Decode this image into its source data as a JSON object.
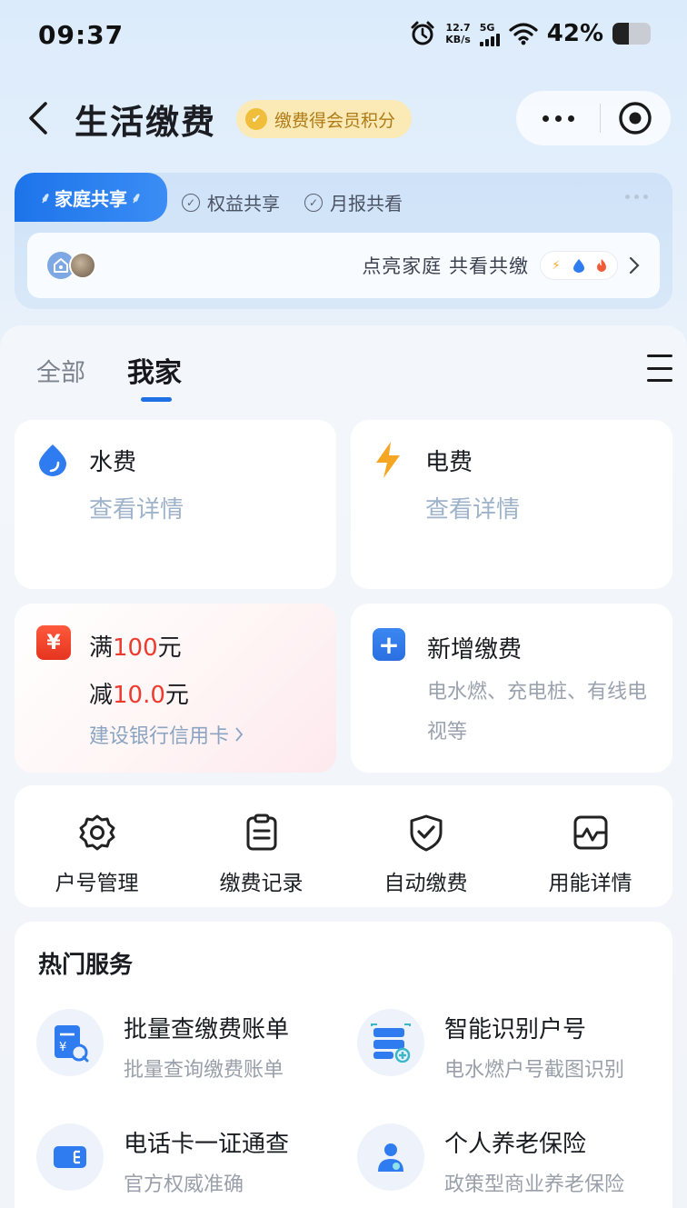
{
  "status_bar": {
    "time": "09:37",
    "net_speed_value": "12.7",
    "net_speed_unit": "KB/s",
    "network": "5G",
    "battery": "42%",
    "battery_level": 0.42
  },
  "header": {
    "title": "生活缴费",
    "points_badge": "缴费得会员积分"
  },
  "family": {
    "tab_label": "家庭共享",
    "share_items": [
      "权益共享",
      "月报共看"
    ],
    "prompt": "点亮家庭 共看共缴"
  },
  "tabs": [
    {
      "label": "全部",
      "active": false
    },
    {
      "label": "我家",
      "active": true
    }
  ],
  "cards": {
    "water": {
      "title": "水费",
      "sub": "查看详情"
    },
    "electric": {
      "title": "电费",
      "sub": "查看详情"
    },
    "promo": {
      "line1_prefix": "满",
      "line1_amount": "100",
      "line1_suffix": "元",
      "line2_prefix": "减",
      "line2_amount": "10.0",
      "line2_suffix": "元",
      "link": "建设银行信用卡"
    },
    "new_payment": {
      "title": "新增缴费",
      "desc": "电水燃、充电桩、有线电视等"
    }
  },
  "quick_actions": [
    {
      "label": "户号管理",
      "icon": "gear-icon"
    },
    {
      "label": "缴费记录",
      "icon": "clipboard-icon"
    },
    {
      "label": "自动缴费",
      "icon": "shield-check-icon"
    },
    {
      "label": "用能详情",
      "icon": "chart-icon"
    }
  ],
  "hot_services": {
    "title": "热门服务",
    "items": [
      {
        "name": "批量查缴费账单",
        "desc": "批量查询缴费账单"
      },
      {
        "name": "智能识别户号",
        "desc": "电水燃户号截图识别"
      },
      {
        "name": "电话卡一证通查",
        "desc": "官方权威准确"
      },
      {
        "name": "个人养老保险",
        "desc": "政策型商业养老保险"
      }
    ]
  },
  "colors": {
    "accent": "#1f6fe5",
    "promo_red": "#ee3b2f",
    "lightning": "#f5a623",
    "water": "#2f7cf0"
  }
}
